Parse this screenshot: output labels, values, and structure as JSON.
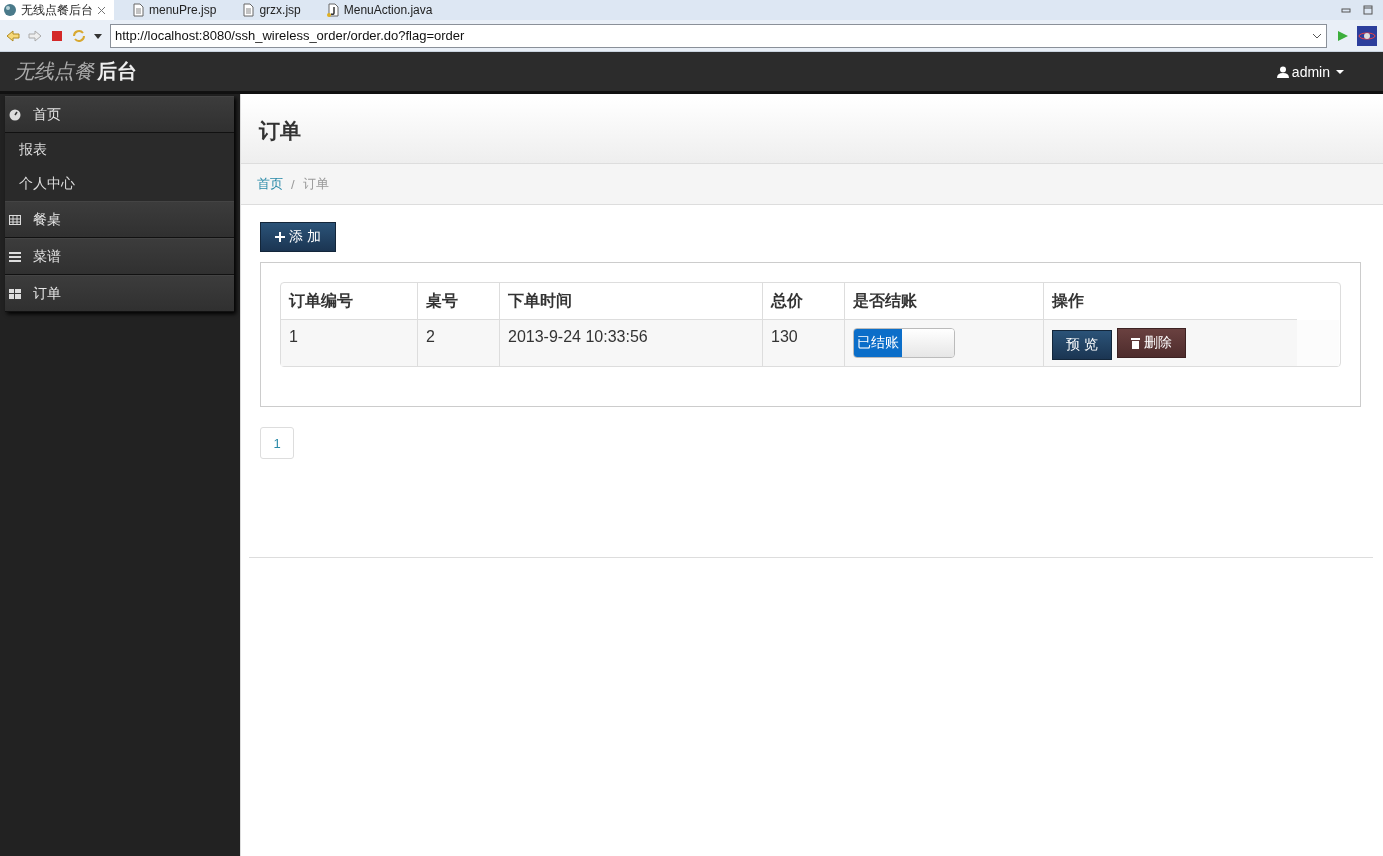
{
  "editor_tabs": [
    {
      "label": "无线点餐后台",
      "selected": true,
      "closable": true
    },
    {
      "label": "menuPre.jsp",
      "selected": false,
      "closable": false
    },
    {
      "label": "grzx.jsp",
      "selected": false,
      "closable": false
    },
    {
      "label": "MenuAction.java",
      "selected": false,
      "closable": false
    }
  ],
  "address": {
    "value": "http://localhost:8080/ssh_wireless_order/order.do?flag=order"
  },
  "navbar": {
    "brand_light": "无线点餐",
    "brand_bold": "后台",
    "user": "admin"
  },
  "sidebar": {
    "items": [
      {
        "label": "首页",
        "kind": "section",
        "children": [
          {
            "label": "报表",
            "kind": "link"
          },
          {
            "label": "个人中心",
            "kind": "link"
          }
        ]
      },
      {
        "label": "餐桌",
        "kind": "section"
      },
      {
        "label": "菜谱",
        "kind": "section"
      },
      {
        "label": "订单",
        "kind": "section"
      }
    ]
  },
  "page": {
    "title": "订单",
    "breadcrumb": [
      {
        "label": "首页",
        "selected": false
      },
      {
        "label": "订单",
        "selected": true
      }
    ],
    "breadcrumb_separator": "/"
  },
  "add_button": "添 加",
  "table": {
    "columns": [
      "订单编号",
      "桌号",
      "下单时间",
      "总价",
      "是否结账",
      "操作"
    ],
    "rows": [
      {
        "id": "1",
        "table_no": "2",
        "time": "2013-9-24 10:33:56",
        "total": "130",
        "paid": {
          "label": "已结账",
          "on": true
        },
        "actions": [
          {
            "label": "预 览",
            "kind": "primary"
          },
          {
            "label": "删除",
            "kind": "danger"
          }
        ]
      }
    ]
  },
  "pagination": [
    {
      "label": "1",
      "selected": false
    }
  ]
}
